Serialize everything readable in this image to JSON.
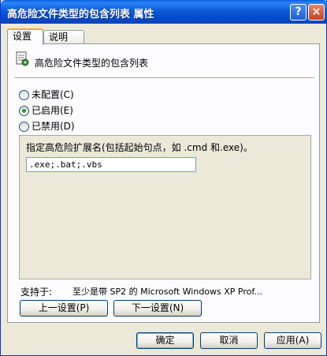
{
  "window": {
    "title": "高危险文件类型的包含列表 属性"
  },
  "titlebar_buttons": {
    "help": "?",
    "close": "×"
  },
  "tabs": [
    {
      "label": "设置",
      "active": true
    },
    {
      "label": "说明",
      "active": false
    }
  ],
  "policy": {
    "icon": "policy-setting-icon",
    "name": "高危险文件类型的包含列表"
  },
  "radios": {
    "unconfigured": {
      "label": "未配置(C)",
      "checked": false
    },
    "enabled": {
      "label": "已启用(E)",
      "checked": true
    },
    "disabled": {
      "label": "已禁用(D)",
      "checked": false
    }
  },
  "options": {
    "label": "指定高危险扩展名(包括起始句点，如 .cmd 和.exe)。",
    "extensions_value": ".exe;.bat;.vbs"
  },
  "supported": {
    "label": "支持于:",
    "value": "至少是带 SP2 的 Microsoft Windows XP Prof..."
  },
  "nav": {
    "prev_label": "上一设置(P)",
    "next_label": "下一设置(N)"
  },
  "dialog_buttons": {
    "ok": "确定",
    "cancel": "取消",
    "apply": "应用(A)"
  },
  "colors": {
    "titlebar": "#0b5bd8",
    "dialog_bg": "#ece9d8",
    "tab_accent": "#f7a823",
    "radio_dot": "#21a121"
  }
}
